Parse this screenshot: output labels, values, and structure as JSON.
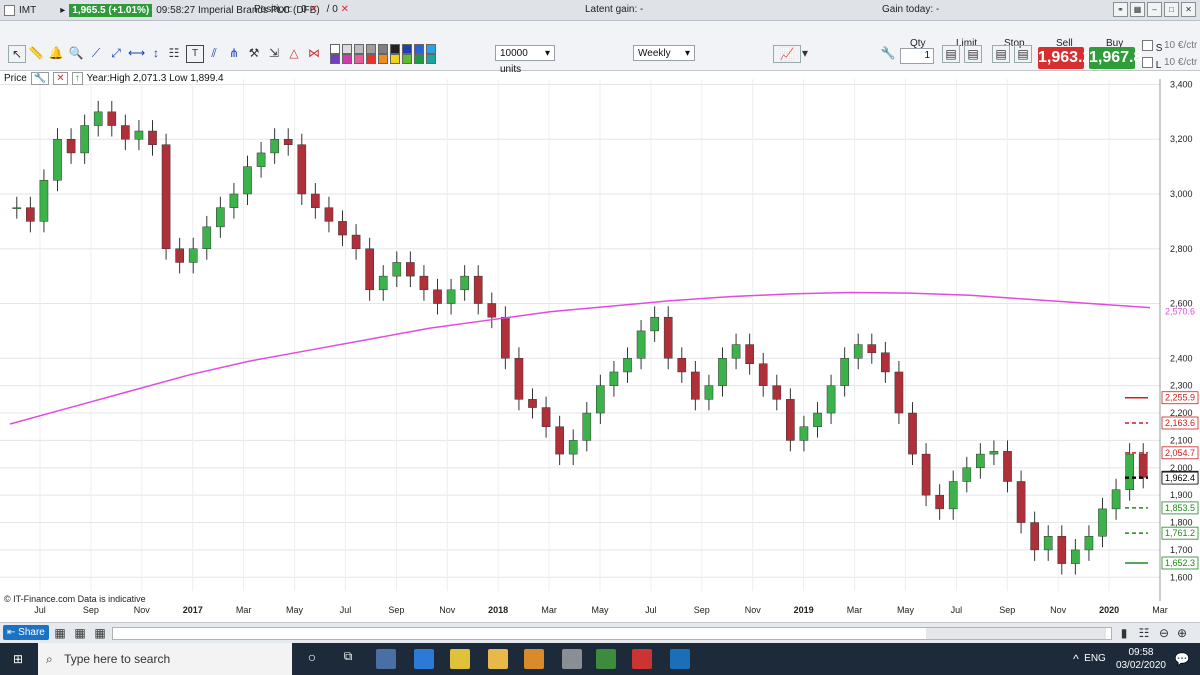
{
  "window": {
    "symbol": "IMT",
    "price_badge": "1,965.5 (+1.01%)",
    "time_title": "09:58:27 Imperial Brands PLC (DFB)"
  },
  "header": {
    "position_label": "Position:",
    "position_value": "0",
    "slash": "/",
    "position_value2": "0",
    "latent_gain_label": "Latent gain:",
    "latent_gain_value": "-",
    "gain_today_label": "Gain today:",
    "gain_today_value": "-"
  },
  "toolbar": {
    "units_select": "10000 units",
    "period_select": "Weekly",
    "qty_label": "Qty",
    "qty_value": "1",
    "limit_label": "Limit",
    "stop_label": "Stop",
    "sell_label": "Sell",
    "buy_label": "Buy",
    "sell_price": "1,963.2",
    "buy_price": "1,967.8",
    "s_label": "S",
    "l_label": "L",
    "s_box": "10",
    "l_box": "10",
    "ctr_label": "€/ctr",
    "colors": [
      "#ffffff",
      "#dcdcdc",
      "#bdbdbd",
      "#9e9e9e",
      "#7f7f7f",
      "#222222",
      "#1e3fae",
      "#2b62d6",
      "#2aa2e8",
      "#6f3fc4",
      "#d23bb0",
      "#e85c9a",
      "#e8332a",
      "#f08c1e",
      "#f2d21e",
      "#5cbf2a",
      "#1c9a44",
      "#1aa5a0"
    ]
  },
  "legend": {
    "price_label": "Price",
    "range_text": "Year:High 2,071.3 Low 1,899.4"
  },
  "copyright": "© IT-Finance.com  Data is indicative",
  "chart_data": {
    "type": "candlestick",
    "period": "Weekly",
    "ylim": [
      1550,
      3420
    ],
    "y_ticks": [
      1600,
      1700,
      1800,
      1900,
      2000,
      2100,
      2200,
      2300,
      2400,
      2500,
      2600,
      2700,
      2800,
      2900,
      3000,
      3100,
      3200,
      3300,
      3400
    ],
    "y_tick_labels": [
      "1,600",
      "",
      "1,700",
      "",
      "1,800",
      "",
      "1,900",
      "",
      "2,000",
      "",
      "2,100",
      "",
      "2,200",
      "",
      "2,300",
      "",
      "2,400",
      "",
      "2,600",
      "",
      "2,800",
      "",
      "3,000",
      "",
      "3,200",
      "",
      "3,400"
    ],
    "y_axis_labels": [
      "3,400",
      "3,200",
      "3,000",
      "2,800",
      "2,600",
      "2,400",
      "2,300",
      "2,200",
      "2,100",
      "2,000",
      "1,900",
      "1,800",
      "1,700",
      "1,600"
    ],
    "x_labels": [
      "Jul",
      "Sep",
      "Nov",
      "2017",
      "Mar",
      "May",
      "Jul",
      "Sep",
      "Nov",
      "2018",
      "Mar",
      "May",
      "Jul",
      "Sep",
      "Nov",
      "2019",
      "Mar",
      "May",
      "Jul",
      "Sep",
      "Nov",
      "2020",
      "Mar"
    ],
    "x_label_bold": [
      "2017",
      "2018",
      "2019",
      "2020"
    ],
    "closes": [
      2950,
      2900,
      3050,
      3200,
      3150,
      3250,
      3300,
      3250,
      3200,
      3230,
      3180,
      2800,
      2750,
      2800,
      2880,
      2950,
      3000,
      3100,
      3150,
      3200,
      3180,
      3000,
      2950,
      2900,
      2850,
      2800,
      2650,
      2700,
      2750,
      2700,
      2650,
      2600,
      2650,
      2700,
      2600,
      2550,
      2400,
      2250,
      2220,
      2150,
      2050,
      2100,
      2200,
      2300,
      2350,
      2400,
      2500,
      2550,
      2400,
      2350,
      2250,
      2300,
      2400,
      2450,
      2380,
      2300,
      2250,
      2100,
      2150,
      2200,
      2300,
      2400,
      2450,
      2420,
      2350,
      2200,
      2050,
      1900,
      1850,
      1950,
      2000,
      2050,
      2060,
      1950,
      1800,
      1700,
      1750,
      1650,
      1700,
      1750,
      1850,
      1920,
      2050,
      1965
    ],
    "ema_line": [
      2160,
      2220,
      2280,
      2340,
      2390,
      2430,
      2470,
      2510,
      2540,
      2570,
      2590,
      2610,
      2625,
      2635,
      2640,
      2638,
      2630,
      2615,
      2600,
      2585
    ],
    "ema_value": "2,570.6",
    "right_labels": [
      {
        "text": "2,255.9",
        "color": "#cc1f1f"
      },
      {
        "text": "2,163.6",
        "color": "#cc1f1f"
      },
      {
        "text": "2,054.7",
        "color": "#cc1f1f"
      },
      {
        "text": "1,965.5",
        "color": "#000000"
      },
      {
        "text": "1,962.4",
        "color": "#000000"
      },
      {
        "text": "1,853.5",
        "color": "#1d8a1d"
      },
      {
        "text": "1,761.2",
        "color": "#1d8a1d"
      },
      {
        "text": "1,652.3",
        "color": "#1d8a1d"
      }
    ],
    "legend_placement": "top-left",
    "grid": true
  },
  "taskbar": {
    "search_placeholder": "Type here to search",
    "lang": "ENG",
    "time": "09:58",
    "date": "03/02/2020",
    "notif": "2"
  }
}
